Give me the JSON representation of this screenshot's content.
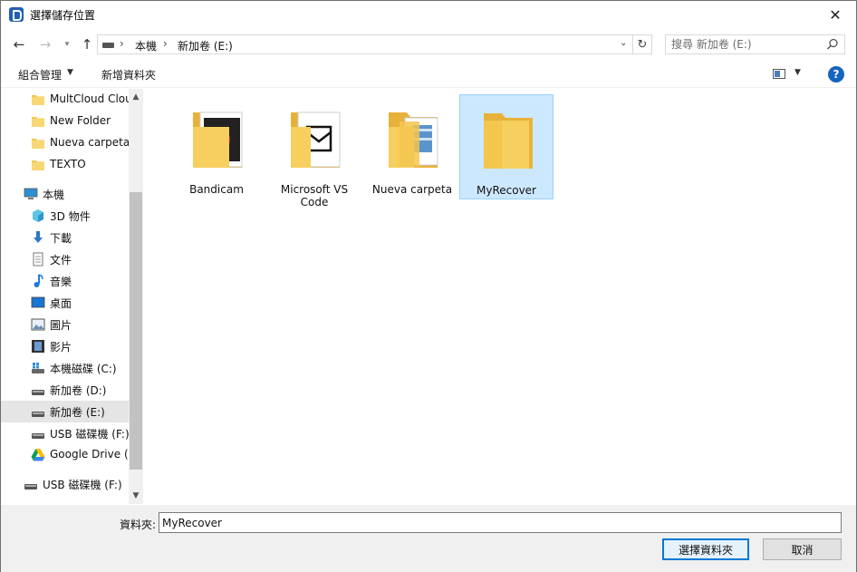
{
  "window": {
    "title": "選擇儲存位置",
    "close_glyph": "✕"
  },
  "nav": {
    "back_glyph": "←",
    "forward_glyph": "→",
    "recent_glyph": "▾",
    "up_glyph": "↑",
    "breadcrumb": [
      "本機",
      "新加卷 (E:)"
    ],
    "breadcrumb_sep": "›",
    "dropdown_glyph": "⌄",
    "refresh_glyph": "↻",
    "search_placeholder": "搜尋 新加卷 (E:)"
  },
  "toolbar": {
    "organize_label": "組合管理",
    "organize_caret": "▼",
    "new_folder_label": "新增資料夾",
    "view_caret": "▼",
    "help_glyph": "?"
  },
  "sidebar": {
    "items": [
      {
        "label": "MultCloud Cloud",
        "icon": "folder-icon",
        "level": 2
      },
      {
        "label": "New Folder",
        "icon": "folder-icon",
        "level": 2
      },
      {
        "label": "Nueva carpeta",
        "icon": "folder-icon",
        "level": 2
      },
      {
        "label": "TEXTO",
        "icon": "folder-icon",
        "level": 2
      },
      {
        "label": "本機",
        "icon": "computer-icon",
        "level": 1
      },
      {
        "label": "3D 物件",
        "icon": "3d-objects-icon",
        "level": 2
      },
      {
        "label": "下載",
        "icon": "download-icon",
        "level": 2
      },
      {
        "label": "文件",
        "icon": "document-icon",
        "level": 2
      },
      {
        "label": "音樂",
        "icon": "music-icon",
        "level": 2
      },
      {
        "label": "桌面",
        "icon": "desktop-icon",
        "level": 2
      },
      {
        "label": "圖片",
        "icon": "pictures-icon",
        "level": 2
      },
      {
        "label": "影片",
        "icon": "videos-icon",
        "level": 2
      },
      {
        "label": "本機磁碟 (C:)",
        "icon": "system-drive-icon",
        "level": 2
      },
      {
        "label": "新加卷 (D:)",
        "icon": "drive-icon",
        "level": 2
      },
      {
        "label": "新加卷 (E:)",
        "icon": "drive-icon",
        "level": 2,
        "selected": true
      },
      {
        "label": "USB 磁碟機 (F:)",
        "icon": "usb-drive-icon",
        "level": 2
      },
      {
        "label": "Google Drive (G:)",
        "icon": "google-drive-icon",
        "level": 2
      },
      {
        "label": "USB 磁碟機 (F:)",
        "icon": "usb-drive-icon",
        "level": 1
      }
    ],
    "scroll_up_glyph": "▲",
    "scroll_down_glyph": "▼"
  },
  "content": {
    "folders": [
      {
        "name": "Bandicam",
        "icon": "bandicam-folder-icon"
      },
      {
        "name": "Microsoft VS Code",
        "icon": "vscode-folder-icon"
      },
      {
        "name": "Nueva carpeta",
        "icon": "documents-folder-icon"
      },
      {
        "name": "MyRecover",
        "icon": "empty-folder-icon",
        "selected": true
      }
    ]
  },
  "bottom": {
    "folder_label": "資料夾:",
    "folder_value": "MyRecover",
    "select_button": "選擇資料夾",
    "cancel_button": "取消"
  },
  "colors": {
    "accent": "#0078d7",
    "selection_fill": "#cce8ff",
    "selection_border": "#99d1ff",
    "folder_yellow": "#f3c64e",
    "help_blue": "#1565c0"
  }
}
